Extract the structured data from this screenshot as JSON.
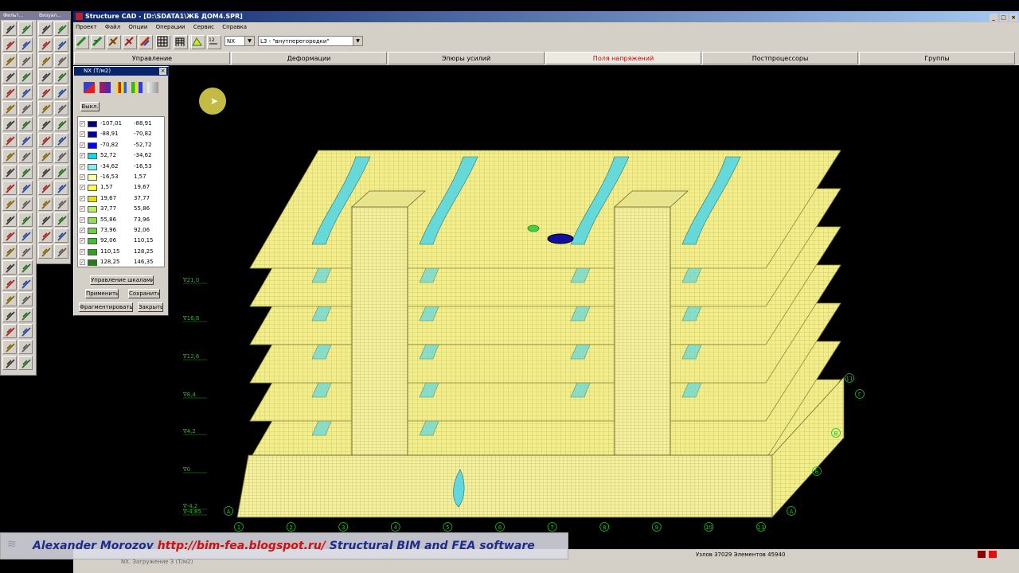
{
  "left_palettes": {
    "palette1_title": "Фильт...",
    "palette2_title": "Визуал..."
  },
  "window": {
    "title": "Structure CAD - [D:\\SDATA1\\ЖБ ДОМ4.SPR]",
    "menu": [
      "Проект",
      "Файл",
      "Опции",
      "Операции",
      "Сервис",
      "Справка"
    ],
    "combo_force": "NX",
    "combo_load": "L3 - \"внутперегородки\"",
    "tabs": [
      "Управление",
      "Деформации",
      "Эпюры усилий",
      "Поля напряжений",
      "Постпроцессоры",
      "Группы"
    ],
    "active_tab_index": 3,
    "active_tab_color": "#e00000"
  },
  "nx_dialog": {
    "title": "NX (Т/м2)",
    "off_button": "Выкл.",
    "legend": [
      {
        "from": "-107,01",
        "to": "-88,91",
        "color": "#000080"
      },
      {
        "from": "-88,91",
        "to": "-70,82",
        "color": "#0000a8"
      },
      {
        "from": "-70,82",
        "to": "-52,72",
        "color": "#0000ff"
      },
      {
        "from": "52,72",
        "to": "-34,62",
        "color": "#00e0e0"
      },
      {
        "from": "-34,62",
        "to": "-16,53",
        "color": "#80f0f0"
      },
      {
        "from": "-16,53",
        "to": "1,57",
        "color": "#ffffa0"
      },
      {
        "from": "1,57",
        "to": "19,67",
        "color": "#ffff40"
      },
      {
        "from": "19,67",
        "to": "37,77",
        "color": "#e8e000"
      },
      {
        "from": "37,77",
        "to": "55,86",
        "color": "#b8f060"
      },
      {
        "from": "55,86",
        "to": "73,96",
        "color": "#90e050"
      },
      {
        "from": "73,96",
        "to": "92,06",
        "color": "#70d040"
      },
      {
        "from": "92,06",
        "to": "110,15",
        "color": "#40c030"
      },
      {
        "from": "110,15",
        "to": "128,25",
        "color": "#30a020"
      },
      {
        "from": "128,25",
        "to": "146,35",
        "color": "#208010"
      }
    ],
    "buttons": {
      "scale": "Управление шкалами",
      "apply": "Применить",
      "save": "Сохранить",
      "fragment": "Фрагментировать",
      "close": "Закрыть"
    }
  },
  "model_view": {
    "level_marks": [
      "∇21,0",
      "∇16,8",
      "∇12,6",
      "∇8,4",
      "∇4,2",
      "∇0",
      "∇-4,2",
      "∇-4,85"
    ],
    "axis_numbers": [
      "1",
      "2",
      "3",
      "4",
      "5",
      "6",
      "7",
      "8",
      "9",
      "10",
      "11"
    ],
    "axis_letters": [
      "А",
      "А",
      "Б",
      "В",
      "Г"
    ],
    "axis_right_11": "11"
  },
  "status": {
    "left": "NX. Загружение 3 (Т/м2)",
    "stats": "Узлов 37029 Элементов 45940"
  },
  "banner": {
    "author": "Alexander Morozov",
    "url": "http://bim-fea.blogspot.ru/",
    "tagline": "Structural BIM and FEA software"
  }
}
